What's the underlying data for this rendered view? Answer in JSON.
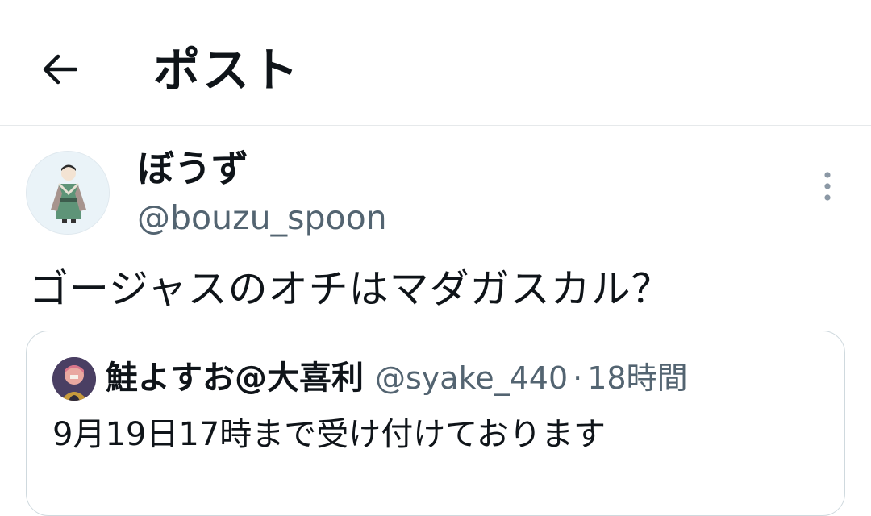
{
  "header": {
    "back_icon": "arrow-left-icon",
    "title": "ポスト"
  },
  "post": {
    "avatar_icon": "avatar-illustration",
    "display_name": "ぼうず",
    "handle": "@bouzu_spoon",
    "more_icon": "more-vertical-icon",
    "text": "ゴージャスのオチはマダガスカル？"
  },
  "quote": {
    "avatar_icon": "avatar-illustration",
    "display_name": "鮭よすお@大喜利",
    "handle": "@syake_440",
    "separator": "·",
    "time": "18時間",
    "text": "9月19日17時まで受け付けております"
  },
  "colors": {
    "text_primary": "#0f1419",
    "text_secondary": "#536471",
    "border": "#cfd9de"
  }
}
